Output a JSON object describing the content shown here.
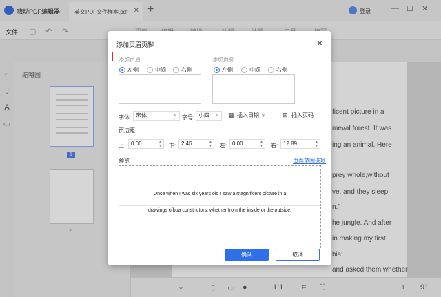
{
  "app": {
    "name": "嗨动PDF编辑器",
    "tab_title": "英文PDF文件样本.pdf",
    "tab_close": "✕",
    "new_tab": "+",
    "login": "登录",
    "win_min": "—",
    "win_max": "☐",
    "win_close": "✕"
  },
  "toolbar": {
    "file_menu": "文件",
    "gray_items": [
      "页面",
      "编辑",
      "转换",
      "注释",
      "批量",
      "工具",
      "填写"
    ],
    "undo_icon": "undo-icon",
    "redo_icon": "redo-icon"
  },
  "thumbnails": {
    "title": "缩略图",
    "page1": "1",
    "page2": "2"
  },
  "doc_lines": [
    "ficent picture in a",
    "meval forest. It was",
    "ing an animal. Here",
    "prey whole,without",
    "ve, and they sleep",
    "n.\"",
    "he jungle. And after",
    "in making my first",
    "his:",
    "and asked them whether"
  ],
  "statusbar": {
    "fit": "1:1",
    "zoom": "91"
  },
  "dialog": {
    "title": "添加页眉页脚",
    "close": "✕",
    "header_label": "添加页眉",
    "footer_label": "添加页脚",
    "align_left": "左侧",
    "align_center": "中间",
    "align_right": "右侧",
    "header_align_selected": "左侧",
    "footer_align_selected": "左侧",
    "font_label": "字体:",
    "font_value": "宋体",
    "size_label": "字号:",
    "size_value": "小四",
    "insert_date": "插入日期",
    "insert_page": "插入页码",
    "margin_label": "页边距",
    "margin_top_label": "上:",
    "margin_top": "0.00",
    "margin_bottom_label": "下:",
    "margin_bottom": "2.46",
    "margin_left_label": "左:",
    "margin_left": "0.00",
    "margin_right_label": "右:",
    "margin_right": "12.89",
    "preview_label": "预览",
    "page_range_link": "页面范围选项",
    "preview_line1": "Once  when  I  was  six  years  old  I  saw  a  magnificent  picture  in  a",
    "preview_line2": "drawings ofboa constrictors,  whether from the inside or the outside,",
    "ok": "确认",
    "cancel": "取消"
  },
  "colors": {
    "accent": "#2f6fe8",
    "highlight_box": "#d9302c",
    "link": "#2f6fe0"
  }
}
